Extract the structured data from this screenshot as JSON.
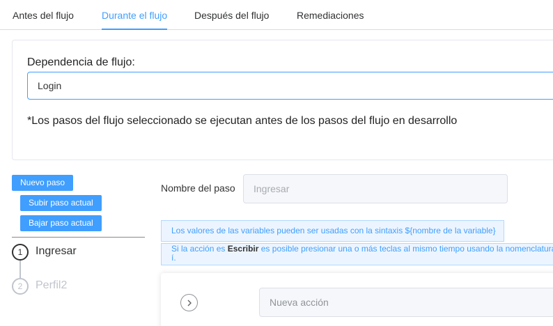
{
  "tabs": [
    {
      "label": "Antes del flujo",
      "active": false
    },
    {
      "label": "Durante el flujo",
      "active": true
    },
    {
      "label": "Después del flujo",
      "active": false
    },
    {
      "label": "Remediaciones",
      "active": false
    }
  ],
  "dependency": {
    "label": "Dependencia de flujo:",
    "value": "Login",
    "note": "*Los pasos del flujo seleccionado se ejecutan antes de los pasos del flujo en desarrollo"
  },
  "buttons": {
    "new_step": "Nuevo paso",
    "move_up": "Subir paso actual",
    "move_down": "Bajar paso actual"
  },
  "steps": [
    {
      "number": "1",
      "label": "Ingresar",
      "active": true
    },
    {
      "number": "2",
      "label": "Perfil2",
      "active": false
    }
  ],
  "step_name": {
    "label": "Nombre del paso",
    "placeholder": "Ingresar"
  },
  "info": {
    "variables": "Los valores de las variables pueden ser usadas con la sintaxis ${nombre de la variable}",
    "keys_prefix": "Si la acción es ",
    "keys_bold": "Escribir",
    "keys_suffix": " es posible presionar una o más teclas al mismo tiempo usando la nomenclatura",
    "keys_wrap": "í."
  },
  "action": {
    "expand_icon": "chevron-right-icon",
    "placeholder": "Nueva acción"
  },
  "colors": {
    "accent": "#409eff",
    "info_bg": "#ecf5ff"
  }
}
